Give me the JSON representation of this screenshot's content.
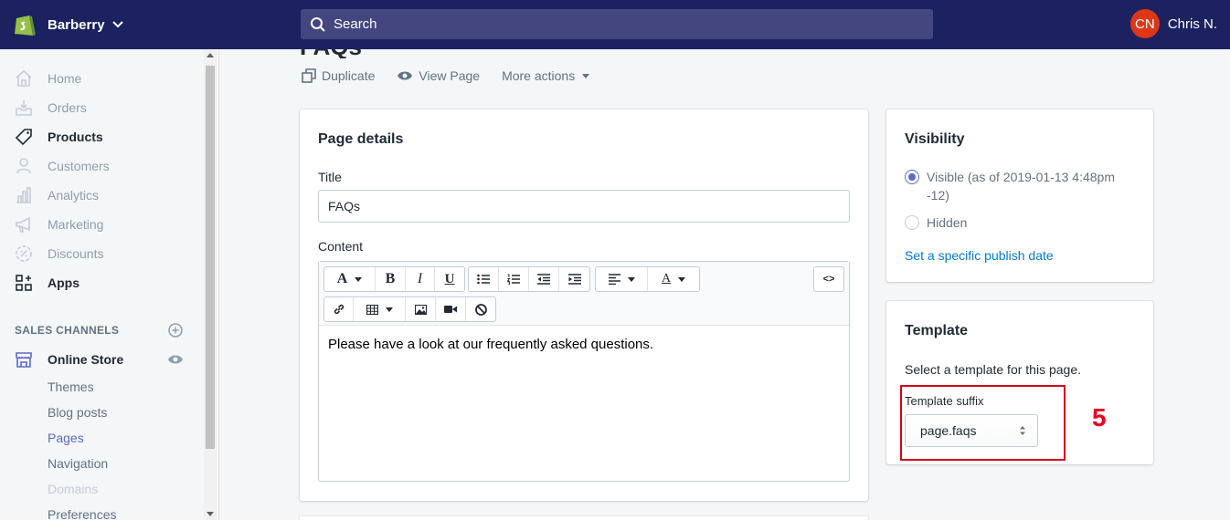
{
  "topbar": {
    "store_name": "Barberry",
    "search_placeholder": "Search",
    "user_initials": "CN",
    "user_name": "Chris N."
  },
  "sidebar": {
    "items": [
      {
        "label": "Home",
        "icon": "home-icon"
      },
      {
        "label": "Orders",
        "icon": "orders-icon"
      },
      {
        "label": "Products",
        "icon": "tag-icon"
      },
      {
        "label": "Customers",
        "icon": "person-icon"
      },
      {
        "label": "Analytics",
        "icon": "bar-chart-icon"
      },
      {
        "label": "Marketing",
        "icon": "megaphone-icon"
      },
      {
        "label": "Discounts",
        "icon": "discount-icon"
      },
      {
        "label": "Apps",
        "icon": "apps-icon"
      }
    ],
    "sales_channels_heading": "SALES CHANNELS",
    "online_store": "Online Store",
    "sub_items": [
      "Themes",
      "Blog posts",
      "Pages",
      "Navigation",
      "Domains",
      "Preferences"
    ]
  },
  "page": {
    "title": "FAQs",
    "actions": {
      "duplicate": "Duplicate",
      "view_page": "View Page",
      "more_actions": "More actions"
    }
  },
  "page_details": {
    "heading": "Page details",
    "title_label": "Title",
    "title_value": "FAQs",
    "content_label": "Content",
    "content_text": "Please have a look at our frequently asked questions.",
    "toolbar": {
      "font_letter": "A",
      "bold": "B",
      "italic": "I",
      "underline": "U",
      "color_letter": "A",
      "html_toggle": "<>"
    }
  },
  "visibility": {
    "heading": "Visibility",
    "visible_label": "Visible (as of 2019-01-13 4:48pm -12)",
    "hidden_label": "Hidden",
    "publish_link": "Set a specific publish date",
    "selected": "visible"
  },
  "template": {
    "heading": "Template",
    "description": "Select a template for this page.",
    "suffix_label": "Template suffix",
    "suffix_value": "page.faqs"
  },
  "annotation": {
    "step_number": "5",
    "color": "#d0021b"
  },
  "colors": {
    "topbar": "#1c2260",
    "accent": "#5c6ac4",
    "link": "#007ace"
  }
}
